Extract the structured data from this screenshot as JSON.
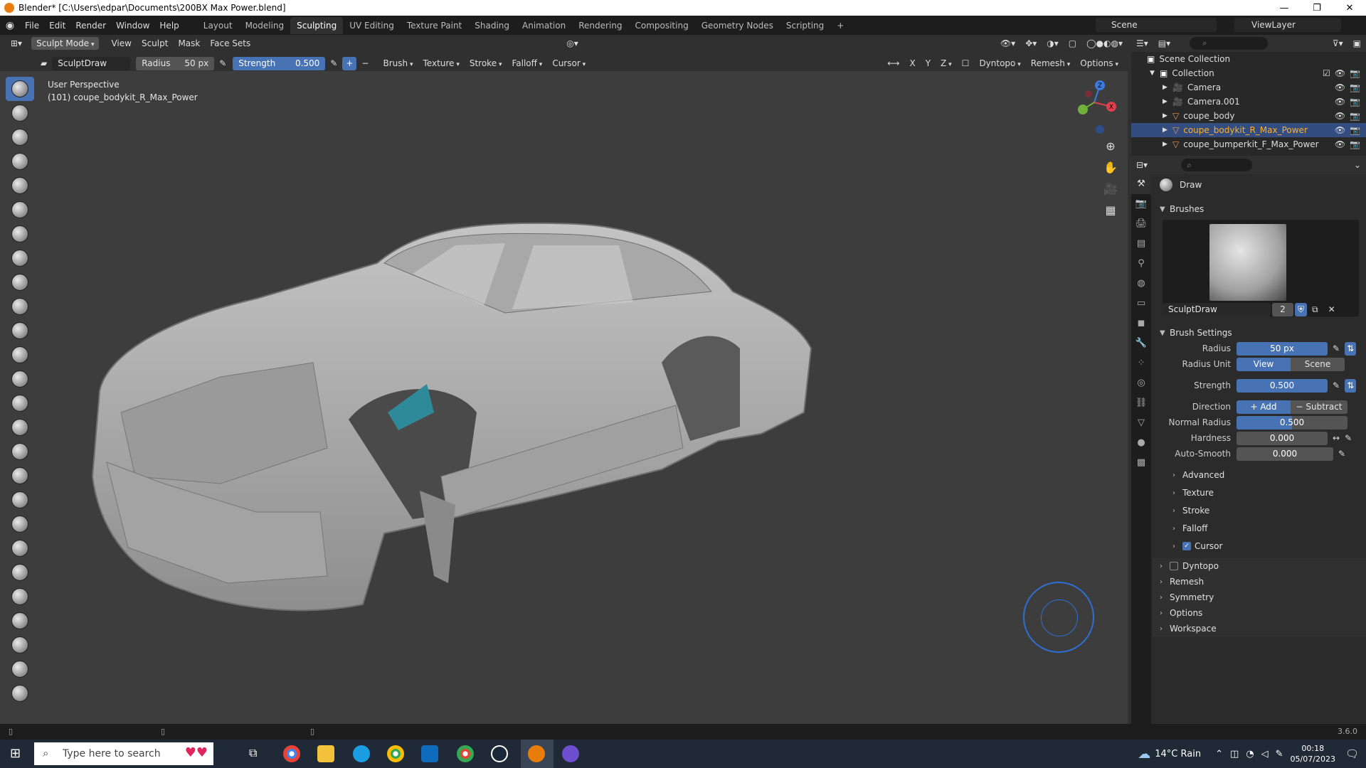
{
  "titlebar": {
    "title": "Blender* [C:\\Users\\edpar\\Documents\\200BX Max Power.blend]"
  },
  "topbar": {
    "menus": [
      "File",
      "Edit",
      "Render",
      "Window",
      "Help"
    ],
    "workspaces": [
      "Layout",
      "Modeling",
      "Sculpting",
      "UV Editing",
      "Texture Paint",
      "Shading",
      "Animation",
      "Rendering",
      "Compositing",
      "Geometry Nodes",
      "Scripting"
    ],
    "active_workspace": "Sculpting",
    "scene": "Scene",
    "view_layer": "ViewLayer"
  },
  "viewport_header": {
    "mode": "Sculpt Mode",
    "menus": [
      "View",
      "Sculpt",
      "Mask",
      "Face Sets"
    ]
  },
  "tool_header": {
    "brush_name": "SculptDraw",
    "radius_label": "Radius",
    "radius_value": "50 px",
    "strength_label": "Strength",
    "strength_value": "0.500",
    "menus": [
      "Brush",
      "Texture",
      "Stroke",
      "Falloff",
      "Cursor"
    ],
    "axes": [
      "X",
      "Y",
      "Z"
    ],
    "dyntopo": "Dyntopo",
    "remesh": "Remesh",
    "options": "Options"
  },
  "viewport": {
    "perspective": "User Perspective",
    "object": "(101) coupe_bodykit_R_Max_Power",
    "gizmo": {
      "z": "Z",
      "x": "X",
      "y": "Y"
    }
  },
  "outliner": {
    "root": "Scene Collection",
    "collection": "Collection",
    "items": [
      "Camera",
      "Camera.001",
      "coupe_body",
      "coupe_bodykit_R_Max_Power",
      "coupe_bumperkit_F_Max_Power"
    ],
    "selected": "coupe_bodykit_R_Max_Power"
  },
  "properties": {
    "tool_name": "Draw",
    "brushes_panel": "Brushes",
    "brush_datablock": "SculptDraw",
    "brush_users": "2",
    "brush_settings_panel": "Brush Settings",
    "radius_label": "Radius",
    "radius_value": "50 px",
    "radius_unit_label": "Radius Unit",
    "radius_unit_view": "View",
    "radius_unit_scene": "Scene",
    "strength_label": "Strength",
    "strength_value": "0.500",
    "strength_fraction": 0.5,
    "direction_label": "Direction",
    "direction_add": "Add",
    "direction_subtract": "Subtract",
    "normal_radius_label": "Normal Radius",
    "normal_radius_value": "0.500",
    "normal_radius_fraction": 0.5,
    "hardness_label": "Hardness",
    "hardness_value": "0.000",
    "auto_smooth_label": "Auto-Smooth",
    "auto_smooth_value": "0.000",
    "subpanels": [
      "Advanced",
      "Texture",
      "Stroke",
      "Falloff",
      "Cursor"
    ],
    "panels": [
      "Dyntopo",
      "Remesh",
      "Symmetry",
      "Options",
      "Workspace"
    ]
  },
  "statusbar": {
    "version": "3.6.0"
  },
  "taskbar": {
    "search_placeholder": "Type here to search",
    "weather": "14°C Rain",
    "time": "00:18",
    "date": "05/07/2023"
  },
  "colors": {
    "accent": "#4772b3",
    "selected_text": "#ffaf29",
    "active_tab": "#303030"
  }
}
